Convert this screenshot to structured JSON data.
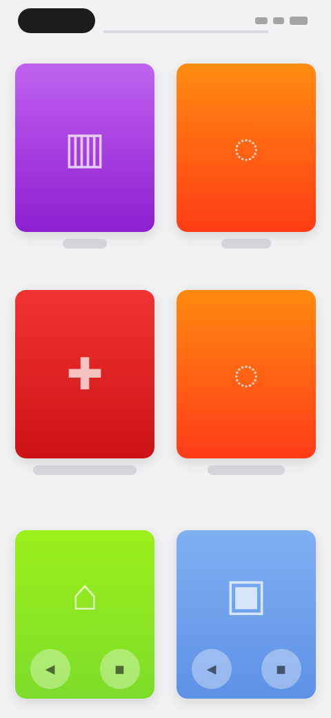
{
  "status": {
    "left_text": "",
    "right_text": ""
  },
  "tiles": [
    {
      "color": "purple",
      "icon": "chart-icon",
      "label": ""
    },
    {
      "color": "orange",
      "icon": "basket-icon",
      "label": ""
    },
    {
      "color": "red",
      "icon": "plus-icon",
      "label": ""
    },
    {
      "color": "orange",
      "icon": "bag-icon",
      "label": ""
    },
    {
      "color": "green",
      "icon": "home-icon",
      "label": ""
    },
    {
      "color": "blue",
      "icon": "media-icon",
      "label": ""
    }
  ],
  "tile_icons": {
    "chart-icon": "▥",
    "basket-icon": "◌",
    "plus-icon": "✚",
    "bag-icon": "◌",
    "home-icon": "⌂",
    "media-icon": "▣"
  },
  "bottom_controls": {
    "left_btn_1": "◀",
    "left_btn_2": "◼",
    "right_btn_1": "◀",
    "right_btn_2": "◼"
  }
}
